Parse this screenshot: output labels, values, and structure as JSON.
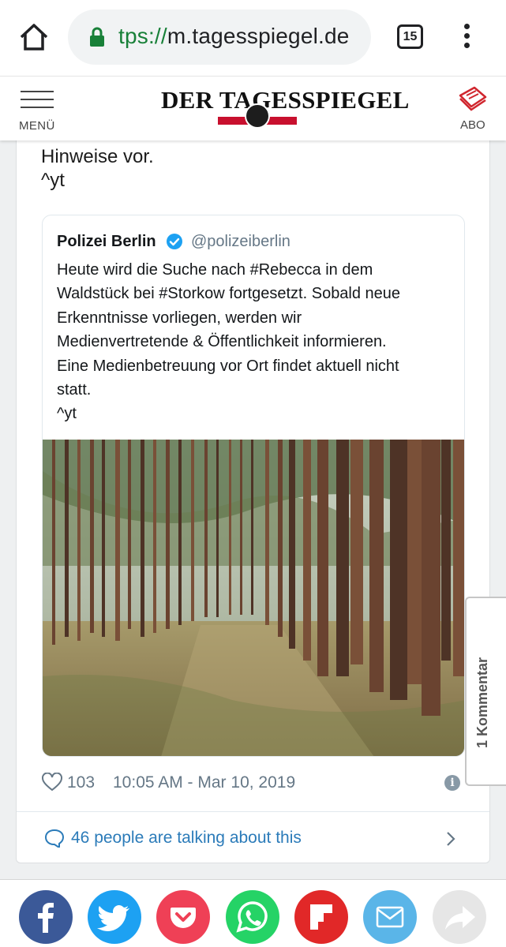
{
  "browser": {
    "url_scheme": "tps://",
    "url_host": "m.tagesspiegel.de",
    "tab_count": "15",
    "icons": [
      "home-icon",
      "lock-icon",
      "tabs-icon",
      "more-vert-icon"
    ]
  },
  "site_header": {
    "menu_label": "MENÜ",
    "logo_text": "DER TAGESSPIEGEL",
    "abo_label": "ABO"
  },
  "embedded_tweet": {
    "text_line_1": "Hinweise vor.",
    "text_line_2": "^yt"
  },
  "quoted_tweet": {
    "name": "Polizei Berlin",
    "handle": "@polizeiberlin",
    "lines": [
      "Heute wird die Suche nach #Rebecca in dem",
      "Waldstück bei #Storkow fortgesetzt. Sobald neue",
      "Erkenntnisse vorliegen, werden wir",
      "Medienvertretende & Öffentlichkeit informieren.",
      "Eine Medienbetreuung vor Ort findet aktuell nicht",
      "statt.",
      "^yt"
    ]
  },
  "tweet_stats": {
    "likes": "103",
    "timestamp": "10:05 AM - Mar 10, 2019",
    "talking": "46 people are talking about this"
  },
  "comment_tab": {
    "label": "1 Kommentar"
  },
  "share": [
    {
      "name": "facebook",
      "color": "#3b5998"
    },
    {
      "name": "twitter",
      "color": "#1da1f2"
    },
    {
      "name": "pocket",
      "color": "#ef4056"
    },
    {
      "name": "whatsapp",
      "color": "#25d366"
    },
    {
      "name": "flipboard",
      "color": "#e12828"
    },
    {
      "name": "email",
      "color": "#5ab5e8"
    },
    {
      "name": "share",
      "color": "#e6e6e6"
    }
  ],
  "colors": {
    "link": "#2b7bb9",
    "secure": "#188038",
    "muted": "#657786",
    "brand_red": "#c8102e"
  }
}
